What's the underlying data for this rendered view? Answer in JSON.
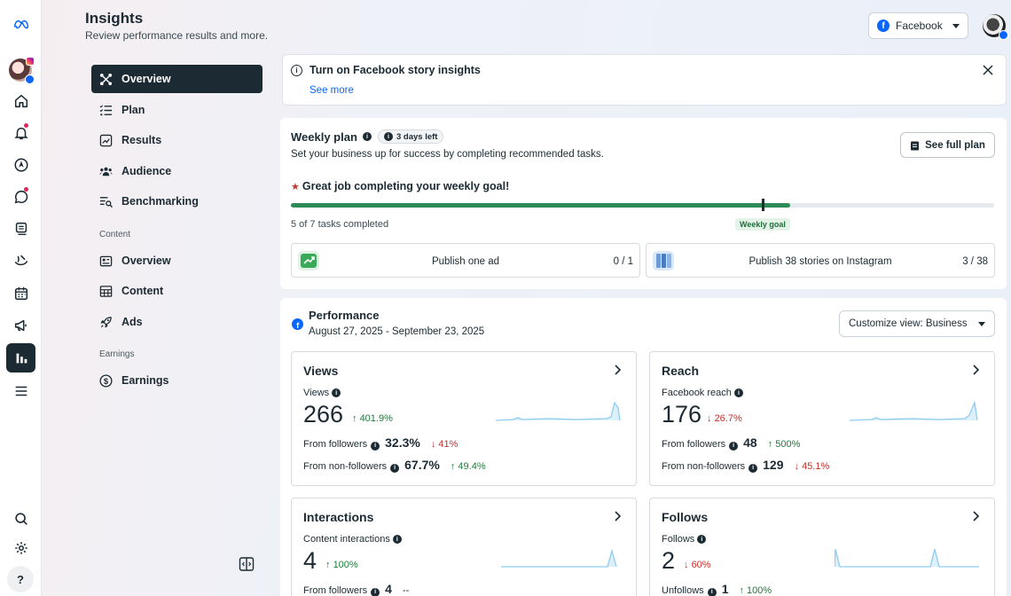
{
  "header": {
    "title": "Insights",
    "subtitle": "Review performance results and more.",
    "platform": "Facebook"
  },
  "sidenav": {
    "main": [
      {
        "label": "Overview",
        "icon": "overview-icon",
        "active": true
      },
      {
        "label": "Plan",
        "icon": "plan-icon"
      },
      {
        "label": "Results",
        "icon": "results-icon"
      },
      {
        "label": "Audience",
        "icon": "audience-icon"
      },
      {
        "label": "Benchmarking",
        "icon": "benchmarking-icon"
      }
    ],
    "content_section": "Content",
    "content": [
      {
        "label": "Overview",
        "icon": "content-overview-icon"
      },
      {
        "label": "Content",
        "icon": "content-grid-icon"
      },
      {
        "label": "Ads",
        "icon": "ads-rocket-icon"
      }
    ],
    "earnings_section": "Earnings",
    "earnings": [
      {
        "label": "Earnings",
        "icon": "dollar-icon"
      }
    ]
  },
  "banner": {
    "title": "Turn on Facebook story insights",
    "link": "See more"
  },
  "weekly_plan": {
    "title": "Weekly plan",
    "days_left": "3 days left",
    "subtitle": "Set your business up for success by completing recommended tasks.",
    "button": "See full plan",
    "goal_message": "Great job completing your weekly goal!",
    "progress": 0.71,
    "goal_position": 0.67,
    "goal_label": "Weekly goal",
    "tasks_completed": "5 of 7 tasks completed",
    "tasks": [
      {
        "label": "Publish one ad",
        "count": "0 / 1"
      },
      {
        "label": "Publish 38 stories on Instagram",
        "count": "3 / 38"
      }
    ]
  },
  "performance": {
    "title": "Performance",
    "date_range": "August 27, 2025 - September 23, 2025",
    "customize": "Customize view: Business",
    "cards": {
      "views": {
        "title": "Views",
        "label": "Views",
        "value": "266",
        "delta": "401.9%",
        "rows": [
          {
            "label": "From followers",
            "value": "32.3%",
            "delta": "41%",
            "dir": "down"
          },
          {
            "label": "From non-followers",
            "value": "67.7%",
            "delta": "49.4%",
            "dir": "up"
          }
        ]
      },
      "reach": {
        "title": "Reach",
        "label": "Facebook reach",
        "value": "176",
        "delta": "26.7%",
        "rows": [
          {
            "label": "From followers",
            "value": "48",
            "delta": "500%",
            "dir": "up"
          },
          {
            "label": "From non-followers",
            "value": "129",
            "delta": "45.1%",
            "dir": "down"
          }
        ]
      },
      "interactions": {
        "title": "Interactions",
        "label": "Content interactions",
        "value": "4",
        "delta": "100%",
        "rows": [
          {
            "label": "From followers",
            "value": "4",
            "delta": "--",
            "dir": "none"
          }
        ]
      },
      "follows": {
        "title": "Follows",
        "label": "Follows",
        "value": "2",
        "delta": "60%",
        "rows": [
          {
            "label": "Unfollows",
            "value": "1",
            "delta": "100%",
            "dir": "up"
          }
        ]
      }
    }
  },
  "colors": {
    "dark": "#1c2b33",
    "facebook_blue": "#0866ff",
    "progress_green": "#2e8b57",
    "up_green": "#1f7a3a",
    "down_red": "#c4302b",
    "spark_blue": "#8ecdf0"
  }
}
